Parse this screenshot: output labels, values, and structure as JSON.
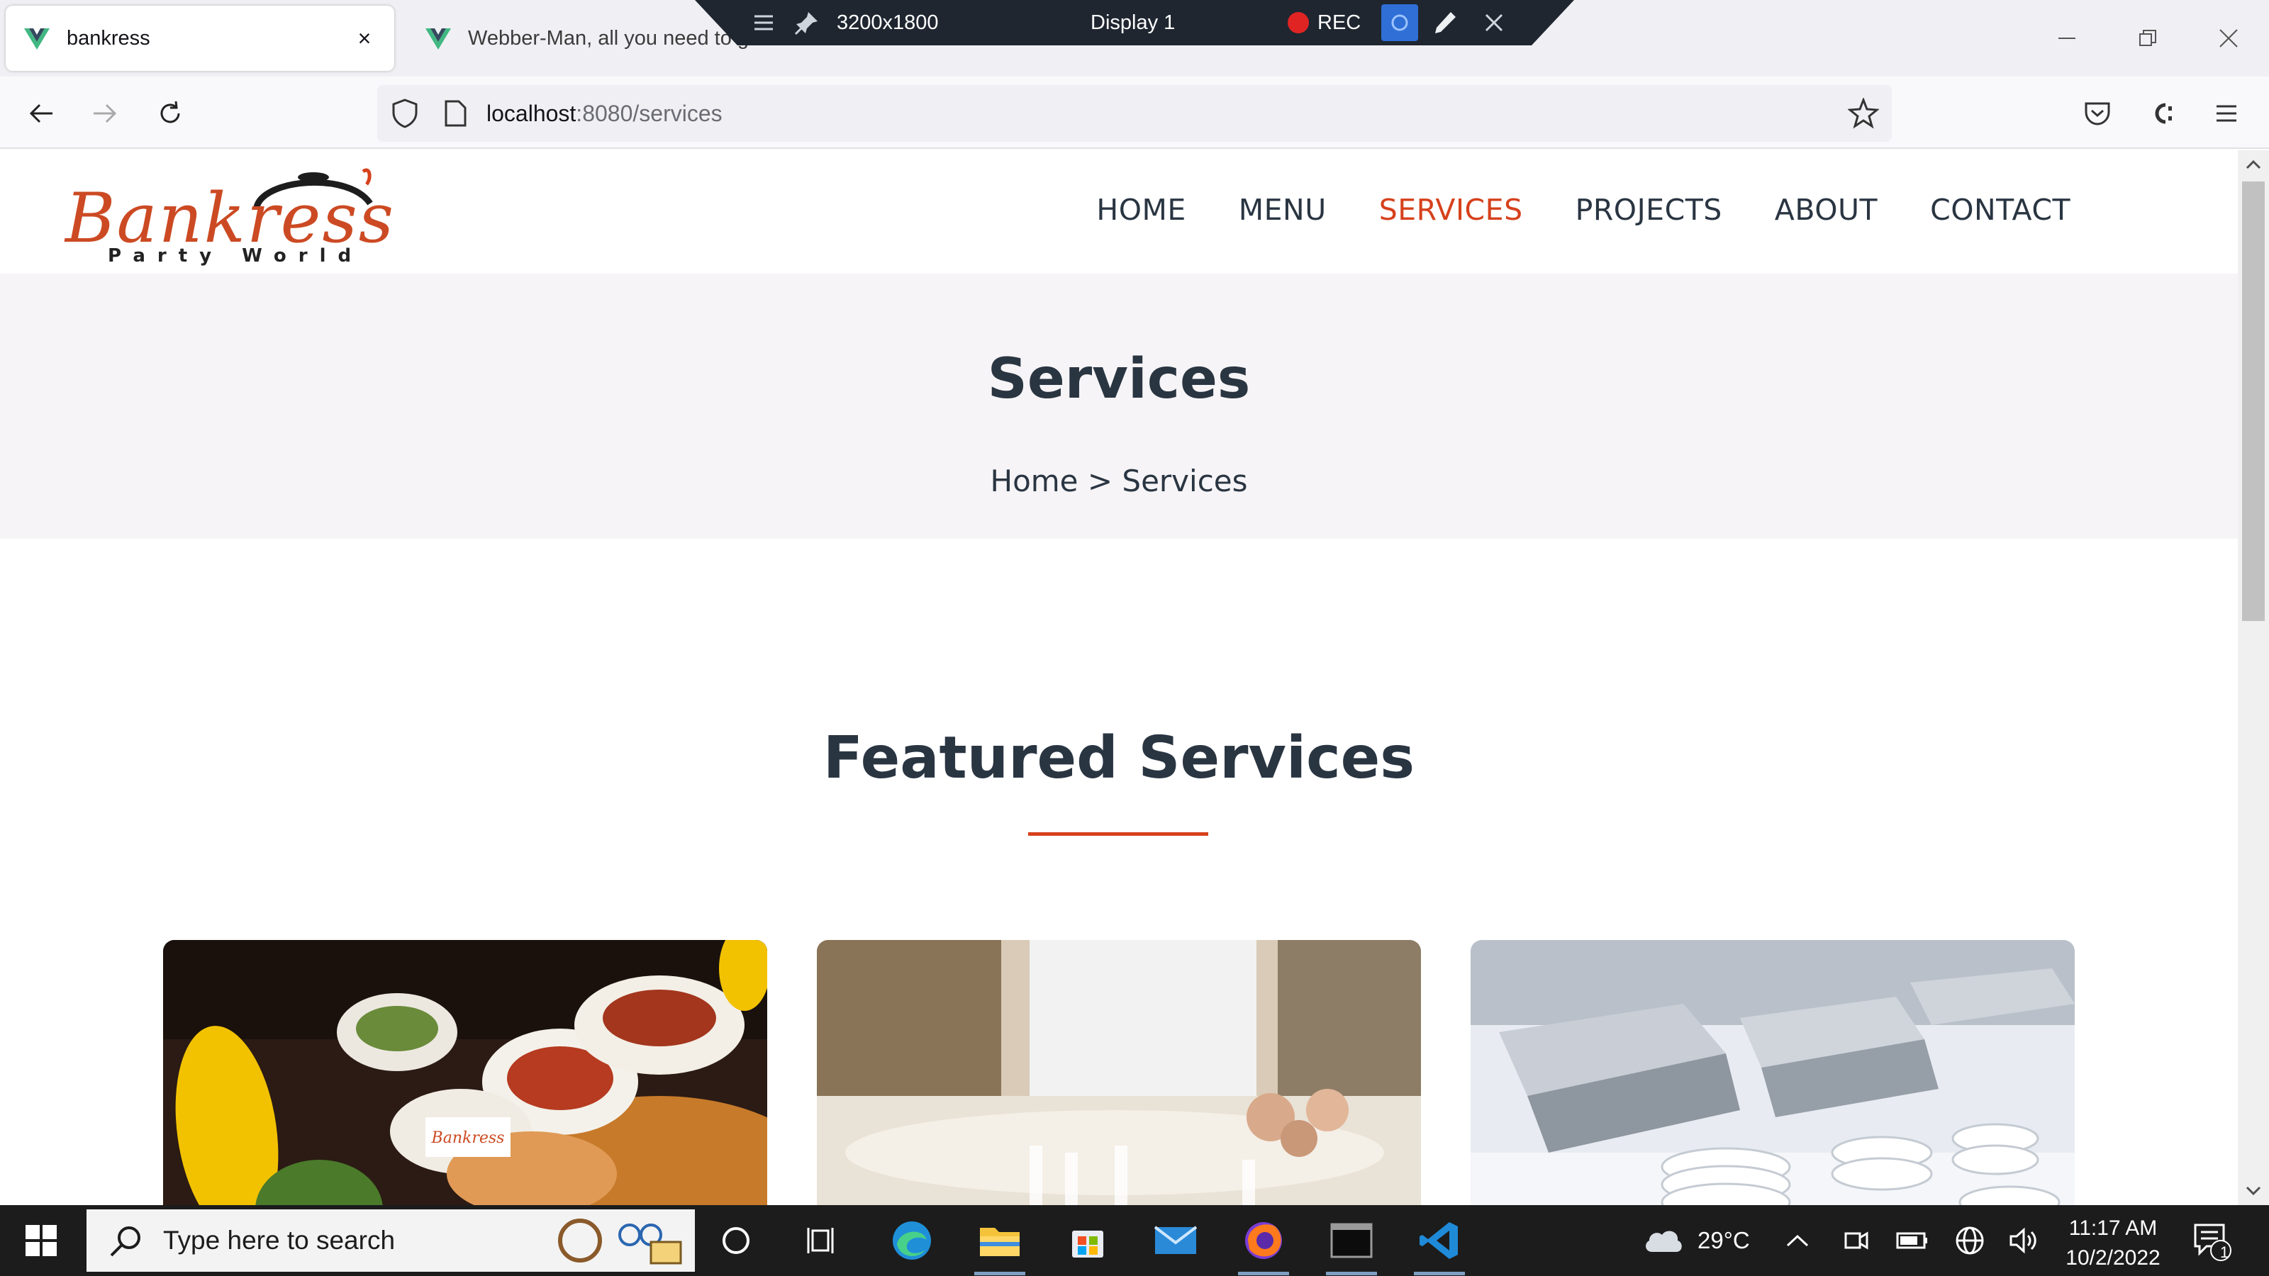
{
  "browser": {
    "tabs": [
      {
        "title": "bankress",
        "active": true
      },
      {
        "title": "Webber-Man, all you need to get your p",
        "active": false
      }
    ],
    "url_host": "localhost",
    "url_path": ":8080/services"
  },
  "recording_bar": {
    "resolution": "3200x1800",
    "display": "Display 1",
    "rec_label": "REC"
  },
  "site": {
    "logo_text": "Bankress",
    "logo_sub": "Party World",
    "menu": [
      {
        "label": "HOME",
        "active": false
      },
      {
        "label": "MENU",
        "active": false
      },
      {
        "label": "SERVICES",
        "active": true
      },
      {
        "label": "PROJECTS",
        "active": false
      },
      {
        "label": "ABOUT",
        "active": false
      },
      {
        "label": "CONTACT",
        "active": false
      }
    ],
    "accent_color": "#d6411c",
    "heading_color": "#2a3542"
  },
  "banner": {
    "title": "Services",
    "breadcrumb": "Home > Services"
  },
  "featured": {
    "title": "Featured Services",
    "cards": [
      {
        "image": "food-platter-photo",
        "watermark": "Bankress"
      },
      {
        "image": "banquet-table-photo"
      },
      {
        "image": "chafing-dishes-photo"
      }
    ]
  },
  "taskbar": {
    "search_placeholder": "Type here to search",
    "weather": "29°C",
    "time": "11:17 AM",
    "date": "10/2/2022",
    "notification_count": "1"
  }
}
